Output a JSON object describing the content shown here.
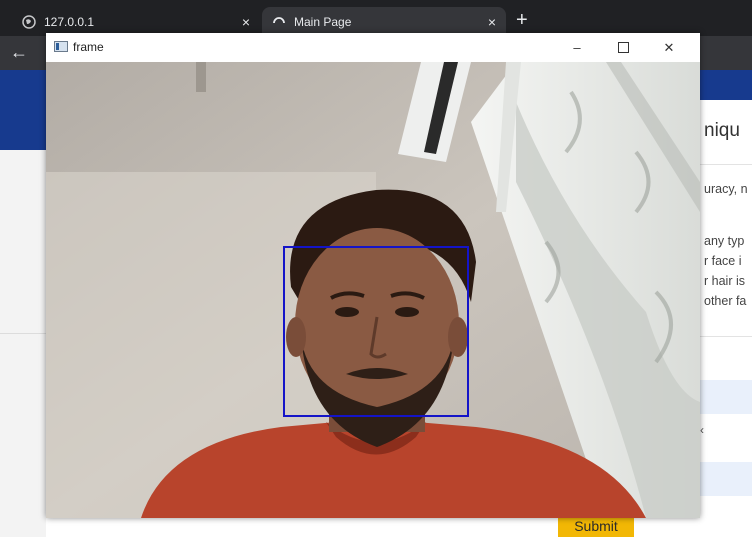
{
  "browser": {
    "tabs": [
      {
        "label": "127.0.0.1",
        "icon": "globe-icon"
      },
      {
        "label": "Main Page",
        "icon": "loading-icon"
      }
    ],
    "close_symbol": "×",
    "new_tab_symbol": "+",
    "back_symbol": "←"
  },
  "window": {
    "title": "frame",
    "minimize": "–",
    "close": "✕"
  },
  "page": {
    "heading": "niqu",
    "lines": [
      "uracy, n",
      "any typ",
      "r face i",
      "r hair is",
      "other fa"
    ],
    "row_marks": [
      "",
      "‹",
      ""
    ],
    "submit_label": "Submit"
  },
  "colors": {
    "face_box": "#1414c8",
    "banner": "#173a8e",
    "submit": "#f2b705"
  }
}
